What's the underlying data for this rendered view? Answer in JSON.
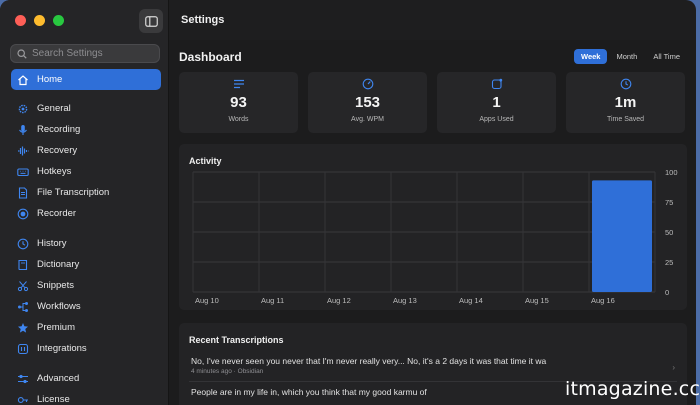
{
  "window": {
    "title": "Settings"
  },
  "search": {
    "placeholder": "Search Settings"
  },
  "sidebar": {
    "items": [
      {
        "label": "Home",
        "icon": "house-icon",
        "active": true
      },
      {
        "label": "General",
        "icon": "gear-icon"
      },
      {
        "label": "Recording",
        "icon": "microphone-icon"
      },
      {
        "label": "Recovery",
        "icon": "waveform-icon"
      },
      {
        "label": "Hotkeys",
        "icon": "keyboard-icon"
      },
      {
        "label": "File Transcription",
        "icon": "document-icon"
      },
      {
        "label": "Recorder",
        "icon": "record-icon"
      },
      {
        "label": "History",
        "icon": "clock-icon"
      },
      {
        "label": "Dictionary",
        "icon": "book-icon"
      },
      {
        "label": "Snippets",
        "icon": "scissors-icon"
      },
      {
        "label": "Workflows",
        "icon": "workflow-icon"
      },
      {
        "label": "Premium",
        "icon": "star-icon"
      },
      {
        "label": "Integrations",
        "icon": "plug-icon"
      },
      {
        "label": "Advanced",
        "icon": "sliders-icon"
      },
      {
        "label": "License",
        "icon": "key-icon"
      }
    ]
  },
  "dashboard": {
    "title": "Dashboard",
    "ranges": [
      "Week",
      "Month",
      "All Time"
    ],
    "selected_range": "Week",
    "stats": [
      {
        "value": "93",
        "label": "Words",
        "icon": "lines-icon"
      },
      {
        "value": "153",
        "label": "Avg. WPM",
        "icon": "speedometer-icon"
      },
      {
        "value": "1",
        "label": "Apps Used",
        "icon": "app-icon"
      },
      {
        "value": "1m",
        "label": "Time Saved",
        "icon": "clock-check-icon"
      }
    ],
    "activity_title": "Activity"
  },
  "chart_data": {
    "type": "bar",
    "categories": [
      "Aug 10",
      "Aug 11",
      "Aug 12",
      "Aug 13",
      "Aug 14",
      "Aug 15",
      "Aug 16"
    ],
    "values": [
      0,
      0,
      0,
      0,
      0,
      0,
      93
    ],
    "ylim": [
      0,
      100
    ],
    "yticks": [
      0,
      25,
      50,
      75,
      100
    ],
    "grid": true,
    "bar_color": "#2f6fd8"
  },
  "recent": {
    "title": "Recent Transcriptions",
    "items": [
      {
        "text": "No, I've never seen you never that I'm never really very... No, it's a 2 days it was that time it wa",
        "time": "4 minutes ago",
        "app": "Obsidian"
      },
      {
        "text": "People are in my life in, which you think that my good karmu of",
        "time": "",
        "app": ""
      }
    ]
  },
  "watermark": "itmagazine.cc"
}
